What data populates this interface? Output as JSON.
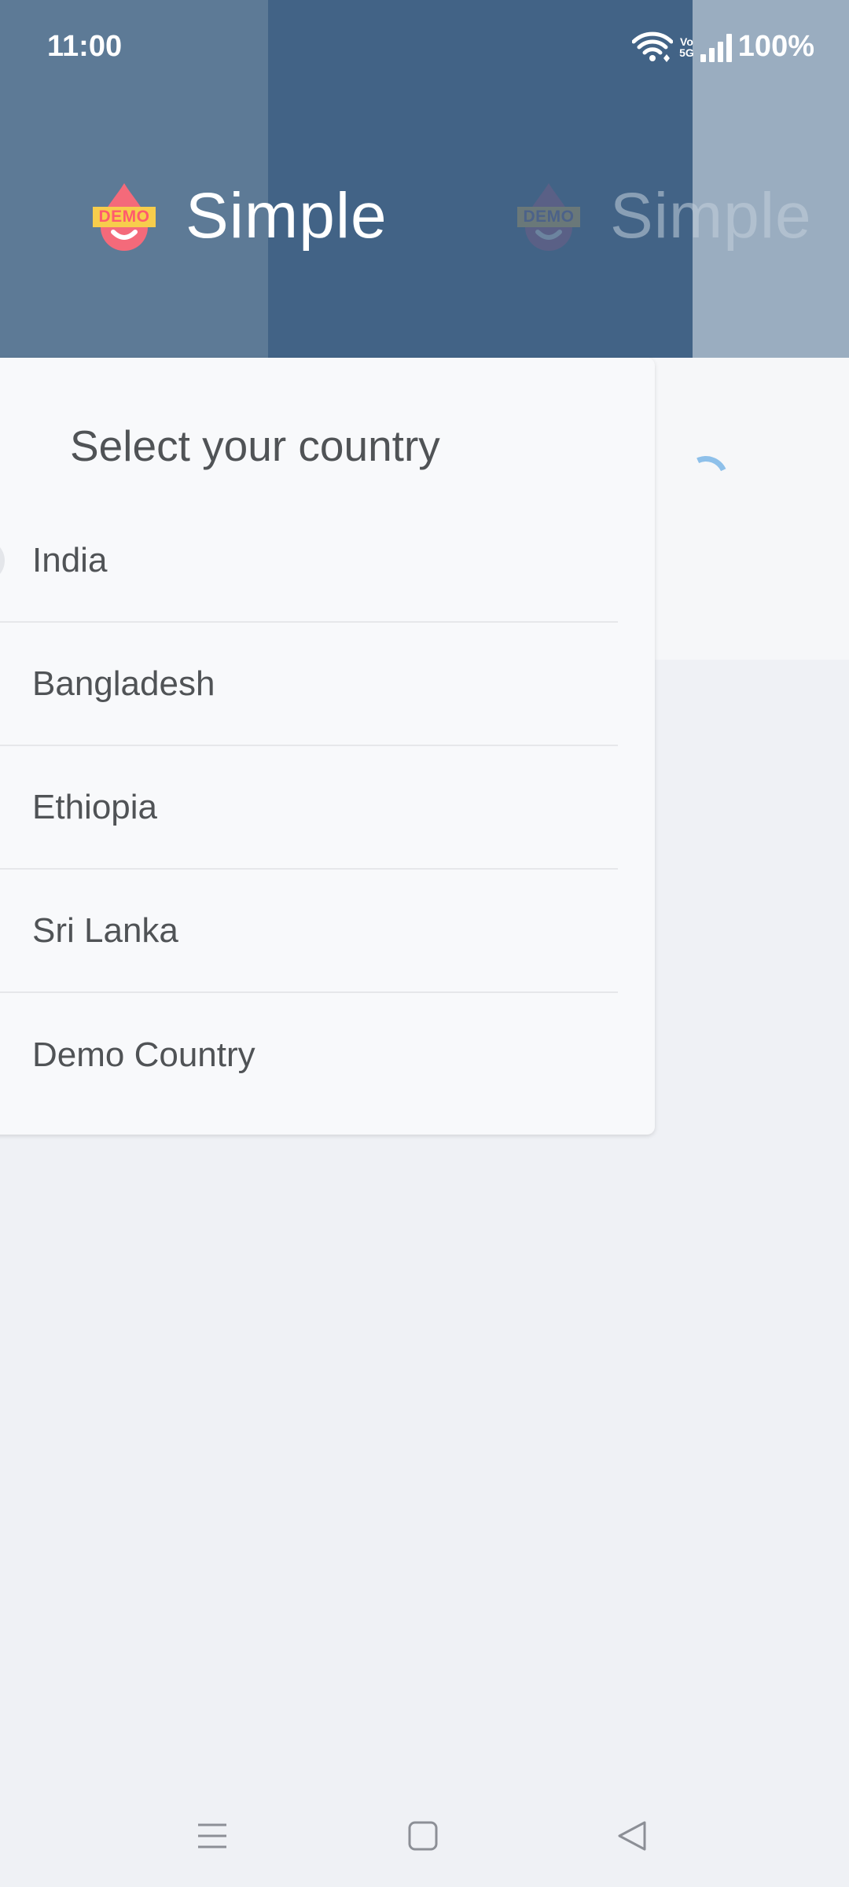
{
  "status_bar": {
    "time": "11:00",
    "network_label_top": "Vo",
    "network_label_bottom": "5G",
    "battery": "100%",
    "icons": [
      "wifi-icon",
      "volte-5g-icon",
      "signal-icon",
      "battery-text"
    ]
  },
  "header": {
    "logo_badge": "DEMO",
    "logo_word": "Simple",
    "colors": {
      "band": "#5d7a96",
      "band_dark": "#426386",
      "drop": "#f46a7a",
      "badge": "#f7cd4c"
    }
  },
  "country_picker": {
    "title": "Select your country",
    "countries": [
      {
        "label": "India"
      },
      {
        "label": "Bangladesh"
      },
      {
        "label": "Ethiopia"
      },
      {
        "label": "Sri Lanka"
      },
      {
        "label": "Demo Country"
      }
    ]
  },
  "loading": {
    "spinner": "loading-spinner-icon",
    "color": "#8ec0ea"
  },
  "nav_bar": {
    "buttons": [
      "recent-apps-icon",
      "home-icon",
      "back-icon"
    ]
  }
}
